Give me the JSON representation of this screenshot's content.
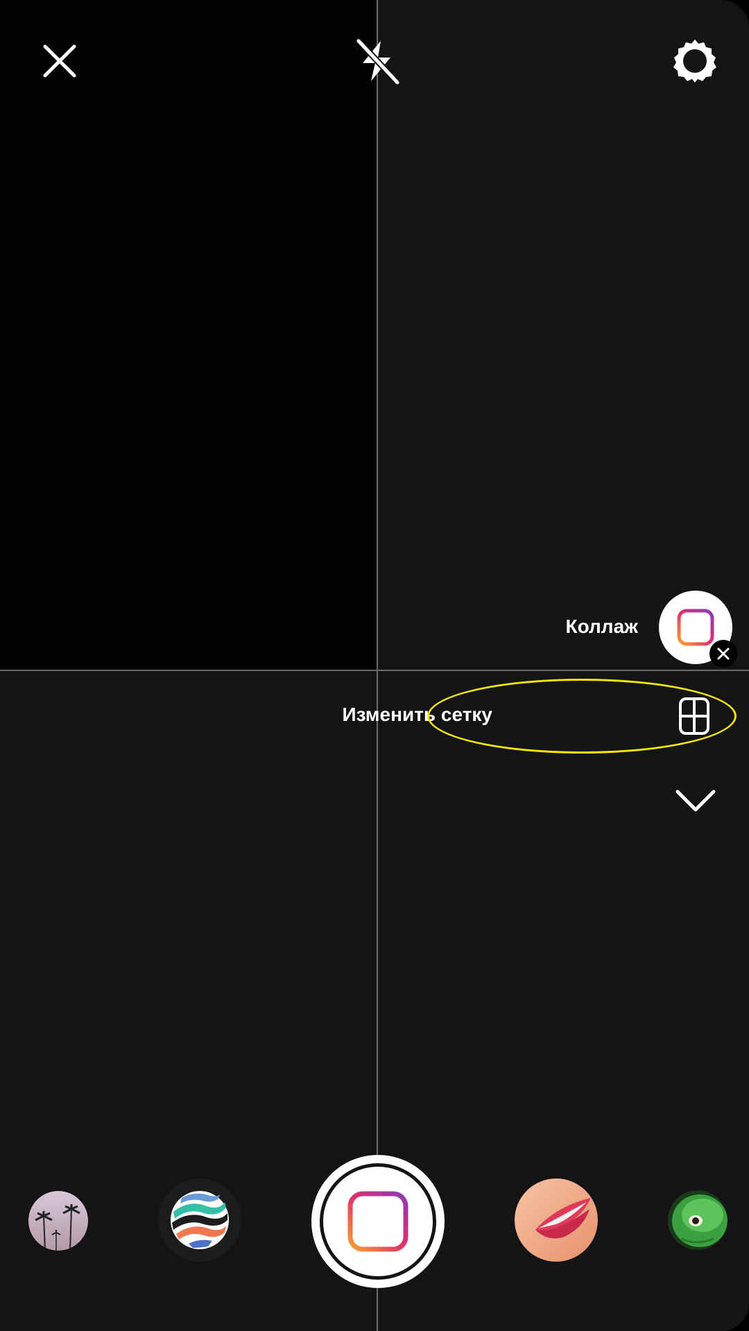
{
  "top_bar": {
    "close_icon": "close-icon",
    "flash_icon": "flash-off-icon",
    "settings_icon": "gear-icon"
  },
  "collage_mode": {
    "label": "Коллаж",
    "icon": "layout-collage-icon",
    "close_icon": "close-icon"
  },
  "grid_option": {
    "label": "Изменить сетку",
    "icon": "grid-four-icon",
    "highlight_color": "#f2e600"
  },
  "collapse": {
    "icon": "chevron-down-icon"
  },
  "effects_carousel": [
    {
      "name": "palm-trees-effect",
      "icon": "palm-trees-thumbnail"
    },
    {
      "name": "stripes-effect",
      "icon": "color-stripes-thumbnail"
    },
    {
      "name": "capture-button",
      "icon": "layout-collage-icon"
    },
    {
      "name": "lips-effect",
      "icon": "lips-thumbnail"
    },
    {
      "name": "alien-effect",
      "icon": "alien-thumbnail"
    }
  ],
  "colors": {
    "background": "#141414",
    "active_cell": "#000000",
    "gradient_start": "#f9a12d",
    "gradient_mid": "#e1306c",
    "gradient_end": "#8a3ab9"
  }
}
